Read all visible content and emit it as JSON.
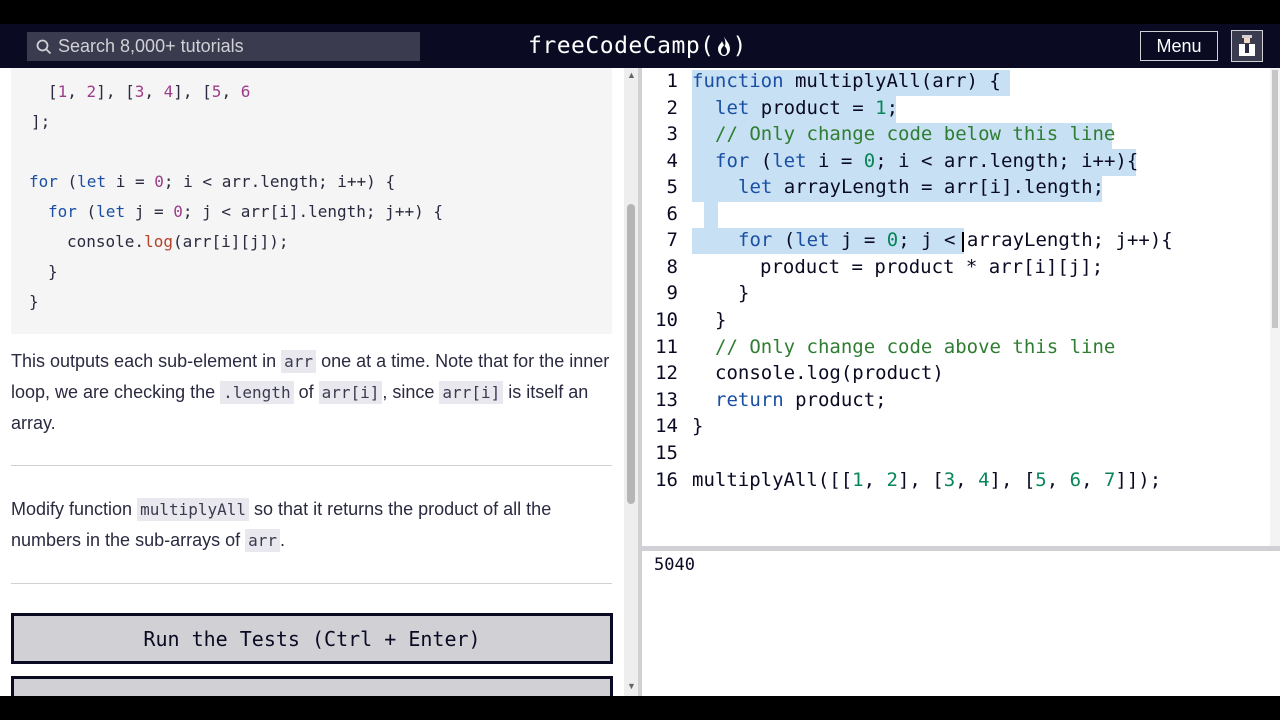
{
  "nav": {
    "search_placeholder": "Search 8,000+ tutorials",
    "logo_text_left": "freeCodeCamp(",
    "logo_text_right": ")",
    "menu_label": "Menu"
  },
  "lesson": {
    "code_lines": {
      "l1_a": "[",
      "l1_n1": "1",
      "l1_b": ", ",
      "l1_n2": "2",
      "l1_c": "], [",
      "l1_n3": "3",
      "l1_d": ", ",
      "l1_n4": "4",
      "l1_e": "], [",
      "l1_n5": "5",
      "l1_f": ", ",
      "l1_n6": "6",
      "l2": "];",
      "l3_kw1": "for",
      "l3_a": " (",
      "l3_kw2": "let",
      "l3_b": " i = ",
      "l3_n": "0",
      "l3_c": "; i < arr.length; i++) {",
      "l4_kw1": "for",
      "l4_a": " (",
      "l4_kw2": "let",
      "l4_b": " j = ",
      "l4_n": "0",
      "l4_c": "; j < arr[i].length; j++) {",
      "l5_a": "console.",
      "l5_fn": "log",
      "l5_b": "(arr[i][j]);",
      "l6": "}",
      "l7": "}"
    },
    "para1": {
      "t1": "This outputs each sub-element in ",
      "c1": "arr",
      "t2": " one at a time. Note that for the inner loop, we are checking the ",
      "c2": ".length",
      "t3": " of ",
      "c3": "arr[i]",
      "t4": ", since ",
      "c4": "arr[i]",
      "t5": " is itself an array."
    },
    "para2": {
      "t1": "Modify function ",
      "c1": "multiplyAll",
      "t2": " so that it returns the product of all the numbers in the sub-arrays of ",
      "c2": "arr",
      "t3": "."
    },
    "run_button": "Run the Tests (Ctrl + Enter)"
  },
  "editor": {
    "line_numbers": [
      "1",
      "2",
      "3",
      "4",
      "5",
      "6",
      "7",
      "8",
      "9",
      "10",
      "11",
      "12",
      "13",
      "14",
      "15",
      "16"
    ],
    "lines": {
      "l1_kw": "function",
      "l1_rest": " multiplyAll(arr) {",
      "l2_kw": "let",
      "l2_a": " product = ",
      "l2_n": "1",
      "l2_b": ";",
      "l3": "// Only change code below this line",
      "l4_kw1": "for",
      "l4_a": " (",
      "l4_kw2": "let",
      "l4_b": " i = ",
      "l4_n": "0",
      "l4_c": "; i < arr.length; i++){",
      "l5_kw": "let",
      "l5_rest": " arrayLength = arr[i].length;",
      "l7_kw1": "for",
      "l7_a": " (",
      "l7_kw2": "let",
      "l7_b": " j = ",
      "l7_n": "0",
      "l7_c": "; j < arrayLength; j++){",
      "l8": "product = product * arr[i][j];",
      "l9": "}",
      "l10": "}",
      "l11": "// Only change code above this line",
      "l12": "console.log(product)",
      "l13_kw": "return",
      "l13_rest": " product;",
      "l14": "}",
      "l16_a": "multiplyAll([[",
      "l16_n1": "1",
      "l16_b": ", ",
      "l16_n2": "2",
      "l16_c": "], [",
      "l16_n3": "3",
      "l16_d": ", ",
      "l16_n4": "4",
      "l16_e": "], [",
      "l16_n5": "5",
      "l16_f": ", ",
      "l16_n6": "6",
      "l16_g": ", ",
      "l16_n7": "7",
      "l16_h": "]]);"
    }
  },
  "output": {
    "value": "5040"
  }
}
